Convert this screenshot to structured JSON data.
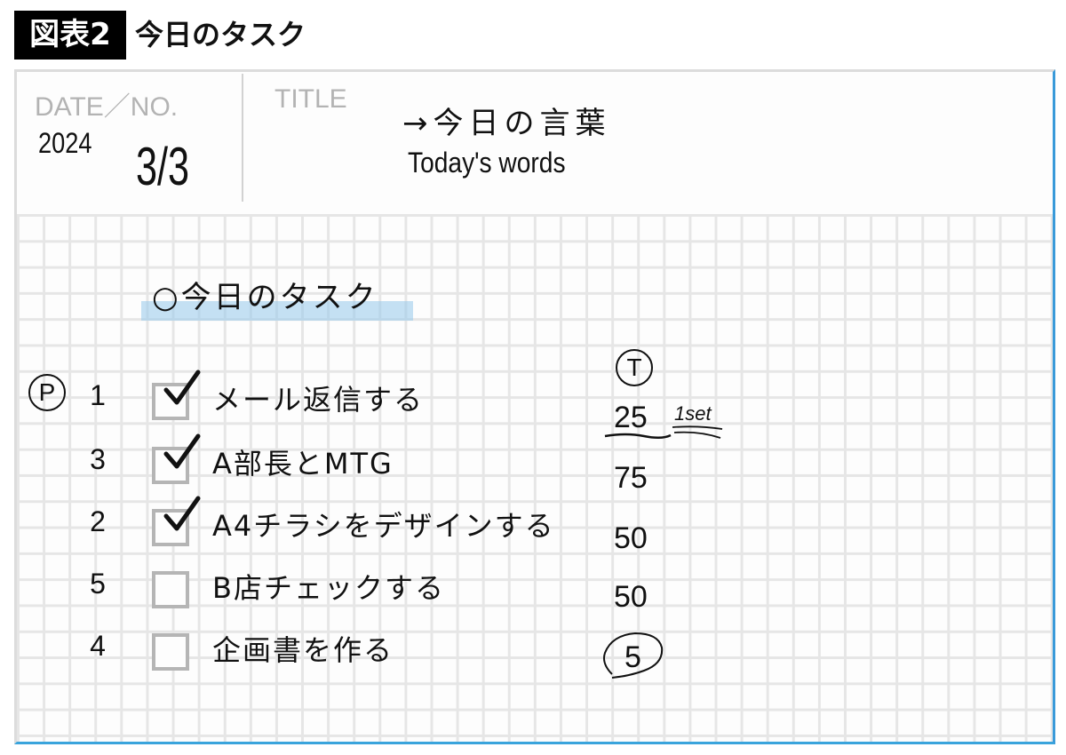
{
  "figure": {
    "label": "図表2",
    "title": "今日のタスク"
  },
  "sheet": {
    "date_label": "DATE／NO.",
    "title_label": "TITLE",
    "year": "2024",
    "date": "3/3",
    "title_jp": "→今日の言葉",
    "title_en": "Today's words"
  },
  "section": {
    "bullet": "○",
    "heading": "今日のタスク"
  },
  "priority_mark": "P",
  "time_mark": "T",
  "tasks": [
    {
      "priority": "1",
      "checked": true,
      "label": "メール返信する",
      "time": "25"
    },
    {
      "priority": "3",
      "checked": true,
      "label": "A部長とMTG",
      "time": "75"
    },
    {
      "priority": "2",
      "checked": true,
      "label": "A4チラシをデザインする",
      "time": "50"
    },
    {
      "priority": "5",
      "checked": false,
      "label": "B店チェックする",
      "time": "50"
    },
    {
      "priority": "4",
      "checked": false,
      "label": "企画書を作る",
      "time": "5"
    }
  ],
  "set_note": "1set",
  "colors": {
    "highlight": "#b5dcf2",
    "border_accent": "#3a9ad9",
    "checkbox": "#b5b5b5"
  }
}
